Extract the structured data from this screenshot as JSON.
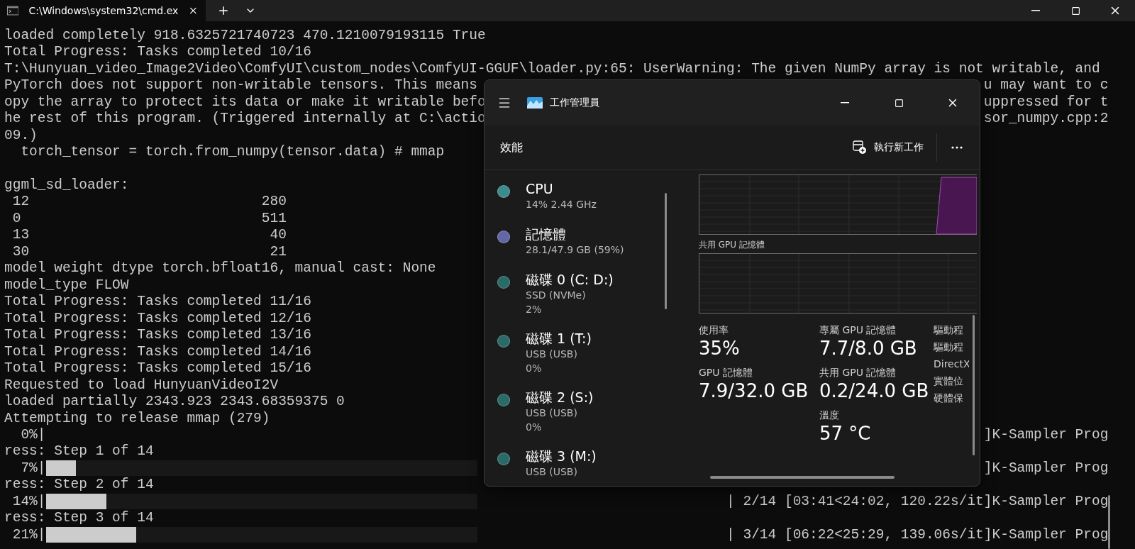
{
  "tab_bar": {
    "tab_title": "C:\\Windows\\system32\\cmd.ex"
  },
  "terminal": {
    "lines": [
      {
        "kind": "text",
        "text": "loaded completely 918.6325721740723 470.1210079193115 True"
      },
      {
        "kind": "text",
        "text": "Total Progress: Tasks completed 10/16"
      },
      {
        "kind": "text",
        "text": "T:\\Hunyuan_video_Image2Video\\ComfyUI\\custom_nodes\\ComfyUI-GGUF\\loader.py:65: UserWarning: The given NumPy array is not writable, and"
      },
      {
        "kind": "split",
        "left": "PyTorch does not support non-writable tensors. This means",
        "right": "u may want to c"
      },
      {
        "kind": "split",
        "left": "opy the array to protect its data or make it writable befo",
        "right": "uppressed for t"
      },
      {
        "kind": "split",
        "left": "he rest of this program. (Triggered internally at C:\\actio",
        "right": "sor_numpy.cpp:2"
      },
      {
        "kind": "text",
        "text": "09.)"
      },
      {
        "kind": "text",
        "text": "  torch_tensor = torch.from_numpy(tensor.data) # mmap"
      },
      {
        "kind": "blank"
      },
      {
        "kind": "text",
        "text": "ggml_sd_loader:"
      },
      {
        "kind": "text",
        "text": " 12                            280"
      },
      {
        "kind": "text",
        "text": " 0                             511"
      },
      {
        "kind": "text",
        "text": " 13                             40"
      },
      {
        "kind": "text",
        "text": " 30                             21"
      },
      {
        "kind": "text",
        "text": "model weight dtype torch.bfloat16, manual cast: None"
      },
      {
        "kind": "text",
        "text": "model_type FLOW"
      },
      {
        "kind": "text",
        "text": "Total Progress: Tasks completed 11/16"
      },
      {
        "kind": "text",
        "text": "Total Progress: Tasks completed 12/16"
      },
      {
        "kind": "text",
        "text": "Total Progress: Tasks completed 13/16"
      },
      {
        "kind": "text",
        "text": "Total Progress: Tasks completed 14/16"
      },
      {
        "kind": "text",
        "text": "Total Progress: Tasks completed 15/16"
      },
      {
        "kind": "text",
        "text": "Requested to load HunyuanVideoI2V"
      },
      {
        "kind": "text",
        "text": "loaded partially 2343.923 2343.68359375 0"
      },
      {
        "kind": "text",
        "text": "Attempting to release mmap (279)"
      },
      {
        "kind": "progress",
        "percent": "  0%|",
        "level": 0,
        "right": "]K-Sampler Prog"
      },
      {
        "kind": "text",
        "text": "ress: Step 1 of 14"
      },
      {
        "kind": "progress",
        "percent": "  7%|",
        "level": 0.07,
        "right": "]K-Sampler Prog"
      },
      {
        "kind": "text",
        "text": "ress: Step 2 of 14"
      },
      {
        "kind": "progress",
        "percent": " 14%|",
        "level": 0.14,
        "right": "| 2/14 [03:41<24:02, 120.22s/it]K-Sampler Prog"
      },
      {
        "kind": "text",
        "text": "ress: Step 3 of 14"
      },
      {
        "kind": "progress",
        "percent": " 21%|",
        "level": 0.21,
        "right": "| 3/14 [06:22<25:29, 139.06s/it]K-Sampler Prog"
      }
    ]
  },
  "task_manager": {
    "title": "工作管理員",
    "page_title": "效能",
    "run_task": "執行新工作",
    "devices": [
      {
        "name": "CPU",
        "details": [
          "14%  2.44 GHz"
        ],
        "color": "#3c8b8d"
      },
      {
        "name": "記憶體",
        "details": [
          "28.1/47.9 GB (59%)"
        ],
        "color": "#6367a6"
      },
      {
        "name": "磁碟 0 (C: D:)",
        "details": [
          "SSD (NVMe)",
          "2%"
        ],
        "color": "#2b6b67"
      },
      {
        "name": "磁碟 1 (T:)",
        "details": [
          "USB (USB)",
          "0%"
        ],
        "color": "#2b6b67"
      },
      {
        "name": "磁碟 2 (S:)",
        "details": [
          "USB (USB)",
          "0%"
        ],
        "color": "#2b6b67"
      },
      {
        "name": "磁碟 3 (M:)",
        "details": [
          "USB (USB)"
        ],
        "color": "#2b6b67"
      }
    ],
    "gpu": {
      "graph_label": "共用 GPU 記憶體",
      "stat_columns": [
        [
          {
            "label": "使用率",
            "value": "35%"
          },
          {
            "label": "GPU 記憶體",
            "value": "7.9/32.0 GB"
          }
        ],
        [
          {
            "label": "專屬 GPU 記憶體",
            "value": "7.7/8.0 GB"
          },
          {
            "label": "共用 GPU 記憶體",
            "value": "0.2/24.0 GB"
          },
          {
            "label": "溫度",
            "value": "57 °C"
          }
        ]
      ],
      "side_labels": [
        "驅動程",
        "驅動程",
        "DirectX",
        "實體位",
        "硬體保"
      ]
    }
  }
}
